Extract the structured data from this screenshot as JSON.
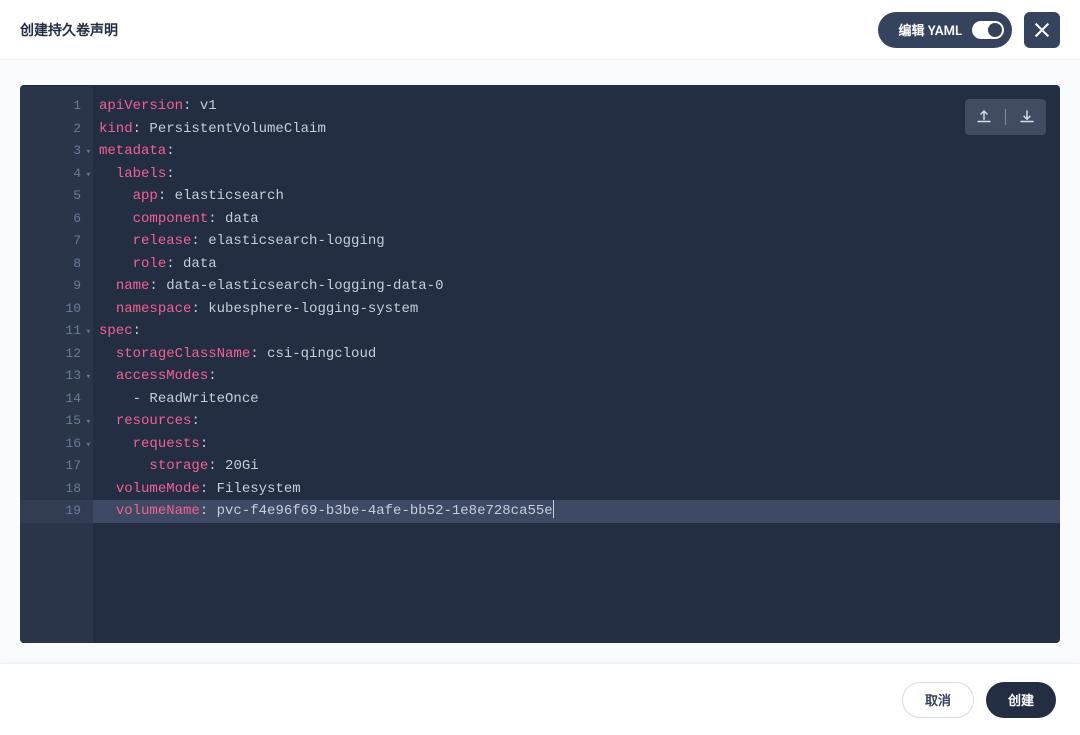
{
  "header": {
    "title": "创建持久卷声明",
    "yaml_toggle_label": "编辑 YAML"
  },
  "footer": {
    "cancel": "取消",
    "create": "创建"
  },
  "yaml": {
    "lines": [
      {
        "n": 1,
        "fold": false,
        "active": false,
        "tokens": [
          [
            "key",
            "apiVersion"
          ],
          [
            "val",
            ": v1"
          ]
        ]
      },
      {
        "n": 2,
        "fold": false,
        "active": false,
        "tokens": [
          [
            "key",
            "kind"
          ],
          [
            "val",
            ": PersistentVolumeClaim"
          ]
        ]
      },
      {
        "n": 3,
        "fold": true,
        "active": false,
        "tokens": [
          [
            "key",
            "metadata"
          ],
          [
            "val",
            ":"
          ]
        ]
      },
      {
        "n": 4,
        "fold": true,
        "active": false,
        "tokens": [
          [
            "indent",
            "  "
          ],
          [
            "key",
            "labels"
          ],
          [
            "val",
            ":"
          ]
        ]
      },
      {
        "n": 5,
        "fold": false,
        "active": false,
        "tokens": [
          [
            "indent",
            "    "
          ],
          [
            "key",
            "app"
          ],
          [
            "val",
            ": elasticsearch"
          ]
        ]
      },
      {
        "n": 6,
        "fold": false,
        "active": false,
        "tokens": [
          [
            "indent",
            "    "
          ],
          [
            "key",
            "component"
          ],
          [
            "val",
            ": data"
          ]
        ]
      },
      {
        "n": 7,
        "fold": false,
        "active": false,
        "tokens": [
          [
            "indent",
            "    "
          ],
          [
            "key",
            "release"
          ],
          [
            "val",
            ": elasticsearch-logging"
          ]
        ]
      },
      {
        "n": 8,
        "fold": false,
        "active": false,
        "tokens": [
          [
            "indent",
            "    "
          ],
          [
            "key",
            "role"
          ],
          [
            "val",
            ": data"
          ]
        ]
      },
      {
        "n": 9,
        "fold": false,
        "active": false,
        "tokens": [
          [
            "indent",
            "  "
          ],
          [
            "key",
            "name"
          ],
          [
            "val",
            ": data-elasticsearch-logging-data-0"
          ]
        ]
      },
      {
        "n": 10,
        "fold": false,
        "active": false,
        "tokens": [
          [
            "indent",
            "  "
          ],
          [
            "key",
            "namespace"
          ],
          [
            "val",
            ": kubesphere-logging-system"
          ]
        ]
      },
      {
        "n": 11,
        "fold": true,
        "active": false,
        "tokens": [
          [
            "key",
            "spec"
          ],
          [
            "val",
            ":"
          ]
        ]
      },
      {
        "n": 12,
        "fold": false,
        "active": false,
        "tokens": [
          [
            "indent",
            "  "
          ],
          [
            "key",
            "storageClassName"
          ],
          [
            "val",
            ": csi-qingcloud"
          ]
        ]
      },
      {
        "n": 13,
        "fold": true,
        "active": false,
        "tokens": [
          [
            "indent",
            "  "
          ],
          [
            "key",
            "accessModes"
          ],
          [
            "val",
            ":"
          ]
        ]
      },
      {
        "n": 14,
        "fold": false,
        "active": false,
        "tokens": [
          [
            "indent",
            "    "
          ],
          [
            "dash",
            "- ReadWriteOnce"
          ]
        ]
      },
      {
        "n": 15,
        "fold": true,
        "active": false,
        "tokens": [
          [
            "indent",
            "  "
          ],
          [
            "key",
            "resources"
          ],
          [
            "val",
            ":"
          ]
        ]
      },
      {
        "n": 16,
        "fold": true,
        "active": false,
        "tokens": [
          [
            "indent",
            "    "
          ],
          [
            "key",
            "requests"
          ],
          [
            "val",
            ":"
          ]
        ]
      },
      {
        "n": 17,
        "fold": false,
        "active": false,
        "tokens": [
          [
            "indent",
            "      "
          ],
          [
            "key",
            "storage"
          ],
          [
            "val",
            ": 20Gi"
          ]
        ]
      },
      {
        "n": 18,
        "fold": false,
        "active": false,
        "tokens": [
          [
            "indent",
            "  "
          ],
          [
            "key",
            "volumeMode"
          ],
          [
            "val",
            ": Filesystem"
          ]
        ]
      },
      {
        "n": 19,
        "fold": false,
        "active": true,
        "tokens": [
          [
            "indent",
            "  "
          ],
          [
            "key",
            "volumeName"
          ],
          [
            "val",
            ": pvc-f4e96f69-b3be-4afe-bb52-1e8e728ca55e"
          ]
        ]
      }
    ]
  }
}
